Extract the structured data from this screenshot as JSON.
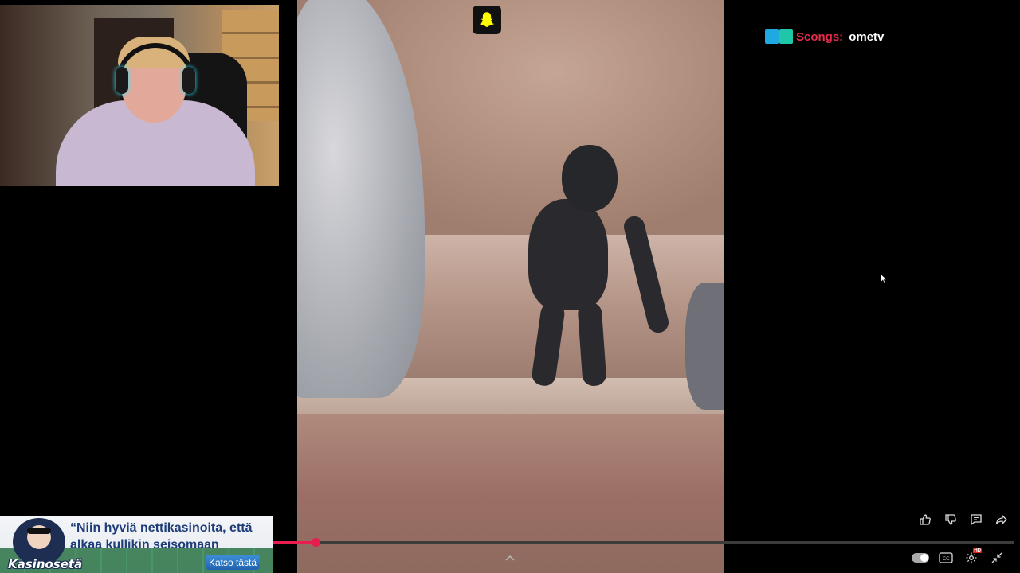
{
  "channel": {
    "label": "Scongs:",
    "value": "ometv",
    "colors": {
      "label": "#e62d4b",
      "value": "#ffffff"
    }
  },
  "overlay_icons": {
    "snapchat": "snapchat-icon"
  },
  "player": {
    "progress_percent": 5.8,
    "accent": "#e81c4f",
    "side_actions": [
      "like-icon",
      "dislike-icon",
      "comments-icon",
      "share-icon"
    ],
    "bottom_controls": [
      "autoplay-toggle",
      "captions-icon",
      "settings-icon",
      "exit-fullscreen-icon"
    ],
    "captions_label": "CC",
    "settings_badge": "HD"
  },
  "ad": {
    "headline": "“Niin hyviä nettikasinoita, että alkaa kullikin seisomaan",
    "brand": "Kasinosetä",
    "cta": "Katso tästä",
    "colors": {
      "headline": "#1e3c78",
      "button": "#2a74c4"
    }
  }
}
